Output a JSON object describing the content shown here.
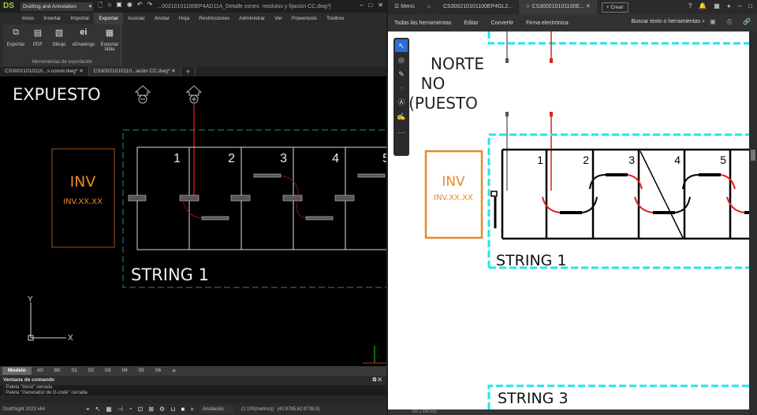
{
  "left": {
    "workspace": "Drafting and Annotation",
    "title": "...00210101100EP4AD11A_Detalle conex. modulos y fijación CC.dwg*]",
    "ribbon_tabs": [
      "Inicio",
      "Insertar",
      "Importar",
      "Exportar",
      "Asociar",
      "Anotar",
      "Hoja",
      "Restricciones",
      "Administrar",
      "Ver",
      "Powertools",
      "Toolbox"
    ],
    "active_ribbon_tab": "Exportar",
    "ribbon_buttons": [
      {
        "label": "Exportar",
        "icon": "export-icon"
      },
      {
        "label": "PDF",
        "icon": "pdf-icon"
      },
      {
        "label": "Dibujo",
        "icon": "drawing-icon"
      },
      {
        "label": "eDrawings",
        "icon": "edrawings-icon"
      },
      {
        "label": "Exportar tabla",
        "icon": "export-table-icon"
      }
    ],
    "ribbon_group": "Herramientas de exportación",
    "doc_tabs": [
      "CS30021010110...s constr.dwg*",
      "CS30021010110...ación CC.dwg*"
    ],
    "drawing": {
      "heading": "EXPUESTO",
      "inv": "INV",
      "inv_id": "INV.XX.XX",
      "string_label": "STRING 1",
      "modules": [
        "1",
        "2",
        "3",
        "4",
        "5"
      ],
      "axis_x": "X",
      "axis_y": "Y"
    },
    "layout_tabs": [
      "Modelo",
      "A0",
      "B0",
      "01",
      "02",
      "03",
      "04",
      "05",
      "06"
    ],
    "command_title": "Ventana de comando",
    "command_lines": [
      ": Paleta \"Inicio\" cerrada",
      ": Paleta \"Generador de G-code\" cerrada"
    ],
    "command_prompt": ":",
    "status": {
      "app": "DraftSight 2023 x64",
      "annotation": "Anotación",
      "scale": "(1:100(metros))",
      "coords": "(40.9785,62.9739,0)"
    }
  },
  "right": {
    "menu": "Menú",
    "tabs": [
      "CS300210101100EP4GL2...",
      "CS300210101100E..."
    ],
    "create": "Crear",
    "toolbar": [
      "Todas las herramientas",
      "Editar",
      "Convertir",
      "Firma electrónica"
    ],
    "search": "Buscar texto o herramientas",
    "drawing": {
      "heading_lines": [
        "NORTE",
        "NO",
        "(PUESTO"
      ],
      "inv": "INV",
      "inv_id": "INV.XX.XX",
      "string1": "STRING 1",
      "string3": "STRING 3",
      "modules": [
        "1",
        "2",
        "3",
        "4",
        "5"
      ]
    },
    "page_size": "420 x 594 mm"
  },
  "colors": {
    "inv": "#e8892a",
    "wire": "#e02020",
    "dashed": "#22e5e8",
    "accent": "#2a6fd6"
  }
}
